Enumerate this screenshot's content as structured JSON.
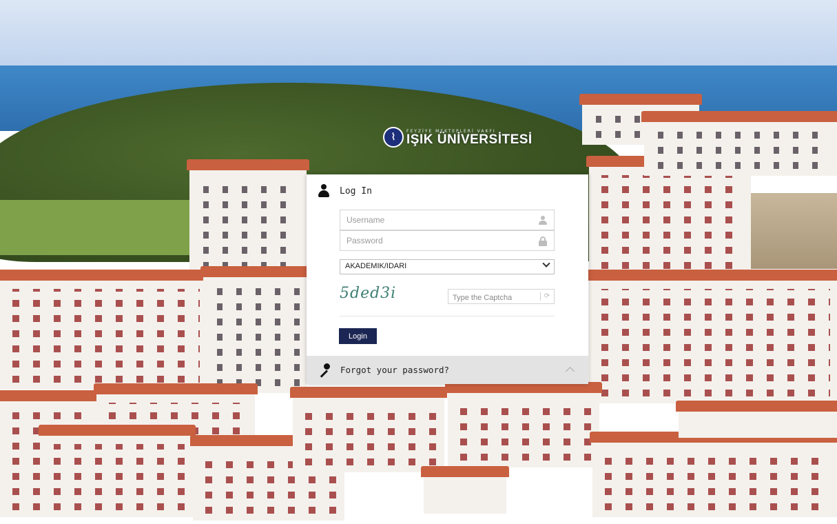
{
  "logo": {
    "subtitle": "FEYZİYE MEKTEPLERİ VAKFI",
    "name": "IŞIK ÜNİVERSİTESİ"
  },
  "login": {
    "title": "Log In",
    "username_placeholder": "Username",
    "password_placeholder": "Password",
    "user_type_selected": "AKADEMIK/IDARI",
    "captcha_text": "5ded3i",
    "captcha_placeholder": "Type the Captcha",
    "login_label": "Login"
  },
  "forgot": {
    "label": "Forgot your password?"
  }
}
